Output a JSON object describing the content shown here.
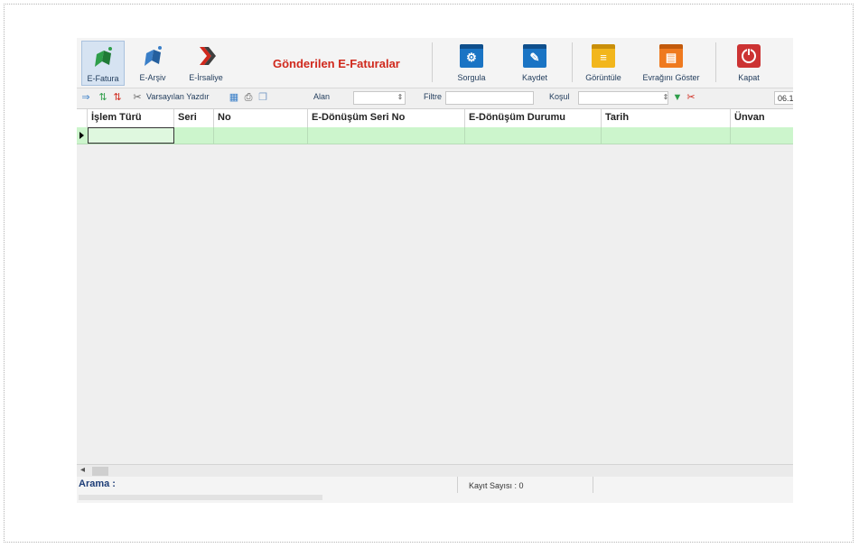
{
  "ribbon": {
    "efatura": "E-Fatura",
    "earsiv": "E-Arşiv",
    "eirsaliye": "E-İrsaliye",
    "title": "Gönderilen E-Faturalar",
    "sorgula": "Sorgula",
    "kaydet": "Kaydet",
    "goruntule": "Görüntüle",
    "evragini_goster": "Evrağını Göster",
    "kapat": "Kapat"
  },
  "toolbar": {
    "varsayilan_yazdir": "Varsayılan Yazdır",
    "alan_label": "Alan",
    "filtre_label": "Filtre",
    "kosul_label": "Koşul",
    "date_value": "06.1"
  },
  "grid": {
    "columns": [
      "İşlem Türü",
      "Seri",
      "No",
      "E-Dönüşüm Seri No",
      "E-Dönüşüm Durumu",
      "Tarih",
      "Ünvan"
    ]
  },
  "status": {
    "arama": "Arama :",
    "kayit_sayisi": "Kayıt Sayısı : 0"
  },
  "colors": {
    "title_red": "#d0291d",
    "row_green": "#ccf5cc",
    "sorgula_blue": "#1a74c4",
    "goruntule_yellow": "#f2b61c",
    "evrak_orange": "#ef7a1f",
    "kapat_red": "#cc3333"
  }
}
